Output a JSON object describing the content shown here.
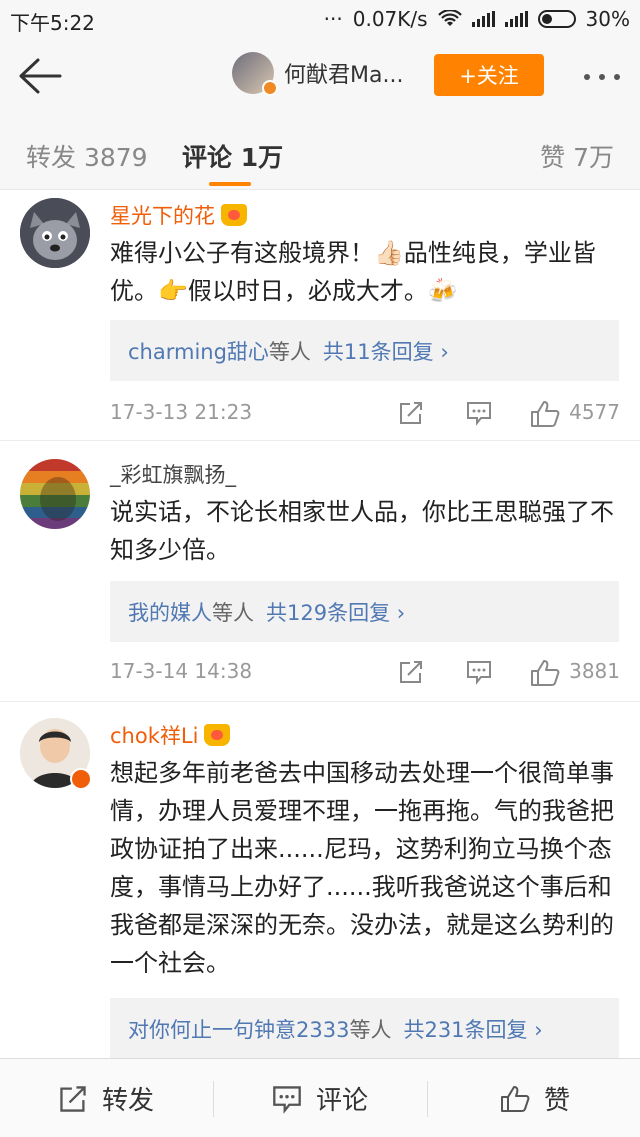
{
  "status_bar": {
    "time": "下午5:22",
    "dots": "···",
    "speed": "0.07K/s",
    "battery": "30%"
  },
  "nav": {
    "title": "何猷君Ma...",
    "follow_label": "+关注"
  },
  "tabs": {
    "repost": "转发 3879",
    "comments": "评论 1万",
    "likes": "赞 7万"
  },
  "comments": [
    {
      "user": "星光下的花",
      "text": "难得小公子有这般境界！👍🏻品性纯良，学业皆优。👉假以时日，必成大才。🍻",
      "reply_users": "charming甜心",
      "reply_mid": "等人",
      "reply_count": "共11条回复",
      "date": "17-3-13 21:23",
      "likes": "4577"
    },
    {
      "user": "_彩虹旗飘扬_",
      "text": "说实话，不论长相家世人品，你比王思聪强了不知多少倍。",
      "reply_users": "我的媒人",
      "reply_mid": "等人",
      "reply_count": "共129条回复",
      "date": "17-3-14 14:38",
      "likes": "3881"
    },
    {
      "user": "chok祥Li",
      "text": "想起多年前老爸去中国移动去处理一个很简单事情，办理人员爱理不理，一拖再拖。气的我爸把政协证拍了出来......尼玛，这势利狗立马换个态度，事情马上办好了......我听我爸说这个事后和我爸都是深深的无奈。没办法，就是这么势利的一个社会。",
      "reply_users": "对你何止一句钟意2333",
      "reply_mid": "等人",
      "reply_count": "共231条回复"
    }
  ],
  "reply_chevron": "›",
  "bottom_bar": {
    "repost": "转发",
    "comment": "评论",
    "like": "赞"
  },
  "icons": {
    "back": "back-arrow-icon",
    "share": "share-icon",
    "comment": "comment-icon",
    "like": "thumbs-up-icon",
    "crown": "vip-crown-icon"
  },
  "colors": {
    "accent": "#ff8200",
    "vip_name": "#f15e0a",
    "link": "#5078b3"
  }
}
